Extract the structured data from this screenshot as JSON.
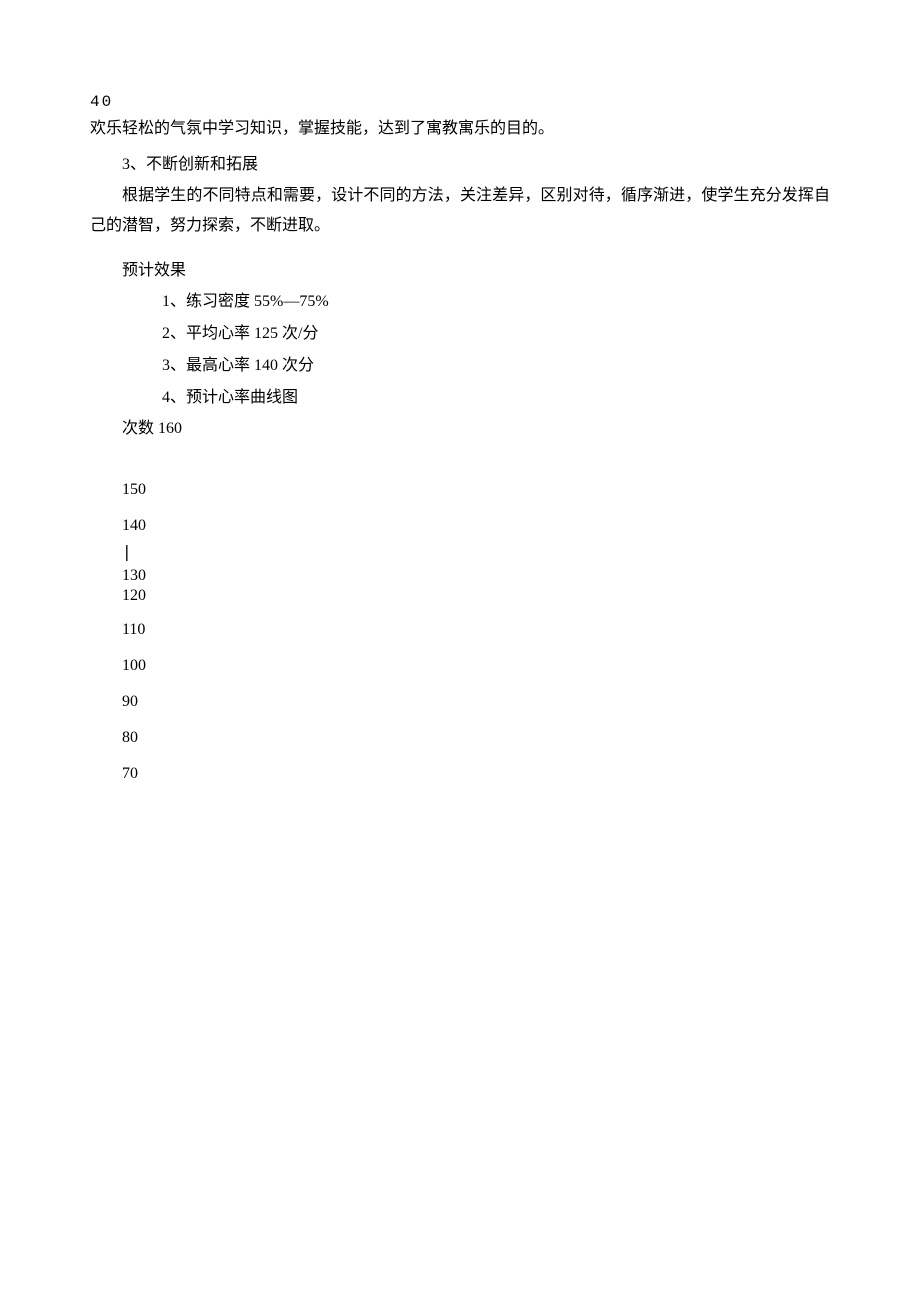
{
  "header": {
    "pageNum": "40"
  },
  "body": {
    "line1": "欢乐轻松的气氛中学习知识，掌握技能，达到了寓教寓乐的目的。",
    "section3_title": "3、不断创新和拓展",
    "section3_body": "根据学生的不同特点和需要，设计不同的方法，关注差异，区别对待，循序渐进，使学生充分发挥自己的潜智，努力探索，不断进取。",
    "expected_title": "预计效果",
    "expected": {
      "item1": "1、练习密度 55%—75%",
      "item2": "2、平均心率 125 次/分",
      "item3": "3、最高心率 140 次分",
      "item4": "4、预计心率曲线图"
    },
    "axis_label_line": "次数 160",
    "yticks": {
      "t150": "150",
      "t140": "140",
      "t130": "130",
      "t120": "120",
      "t110": "110",
      "t100": "100",
      "t90": "90",
      "t80": "80",
      "t70": "70"
    }
  },
  "img_marker": "|"
}
